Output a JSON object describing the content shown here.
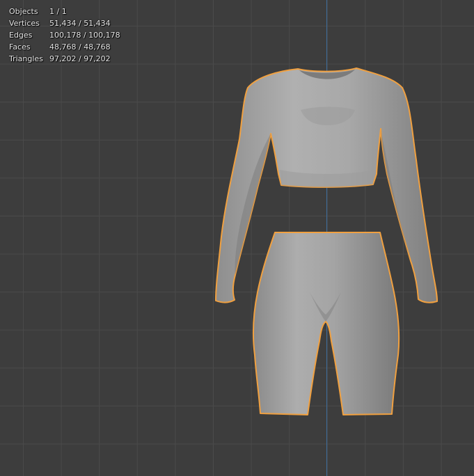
{
  "viewport": {
    "background_color": "#3d3d3d",
    "grid_color": "#4a4a4a",
    "axis_color": "#3e6d9c",
    "selection_outline_color": "#f0a040",
    "mesh_color": "#a6a6a6"
  },
  "stats": [
    {
      "label": "Objects",
      "value": "1 / 1"
    },
    {
      "label": "Vertices",
      "value": "51,434 / 51,434"
    },
    {
      "label": "Edges",
      "value": "100,178 / 100,178"
    },
    {
      "label": "Faces",
      "value": "48,768 / 48,768"
    },
    {
      "label": "Triangles",
      "value": "97,202 / 97,202"
    }
  ]
}
